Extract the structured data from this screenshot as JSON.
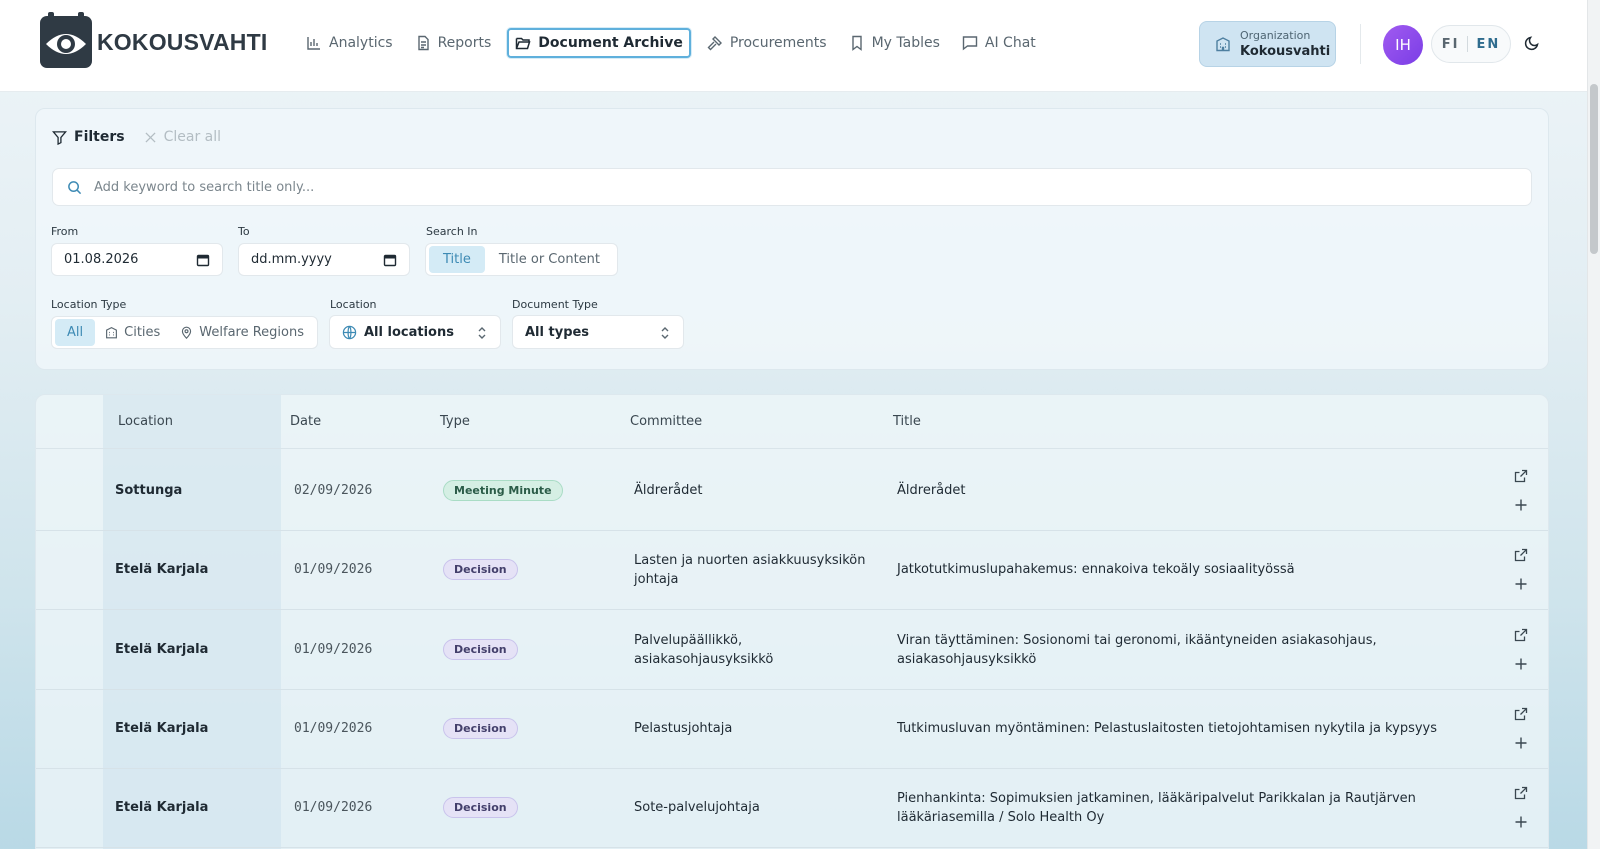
{
  "header": {
    "logo_text": "KOKOUSVAHTI",
    "nav": [
      {
        "label": "Analytics",
        "icon": "bar-chart-icon",
        "active": false
      },
      {
        "label": "Reports",
        "icon": "document-icon",
        "active": false
      },
      {
        "label": "Document Archive",
        "icon": "folder-open-icon",
        "active": true
      },
      {
        "label": "Procurements",
        "icon": "gavel-icon",
        "active": false
      },
      {
        "label": "My Tables",
        "icon": "bookmark-icon",
        "active": false
      },
      {
        "label": "AI Chat",
        "icon": "chat-icon",
        "active": false
      }
    ],
    "org_label": "Organization",
    "org_name": "Kokousvahti",
    "avatar_initials": "IH",
    "lang_fi": "FI",
    "lang_en": "EN"
  },
  "filters": {
    "title": "Filters",
    "clear_all": "Clear all",
    "search_placeholder": "Add keyword to search title only...",
    "from_label": "From",
    "from_value": "01.08.2026",
    "to_label": "To",
    "to_placeholder": "dd.mm.yyyy",
    "search_in_label": "Search In",
    "search_in_options": [
      "Title",
      "Title or Content"
    ],
    "location_type_label": "Location Type",
    "location_type_options": [
      "All",
      "Cities",
      "Welfare Regions"
    ],
    "location_label": "Location",
    "location_value": "All locations",
    "document_type_label": "Document Type",
    "document_type_value": "All types"
  },
  "table": {
    "columns": [
      "Location",
      "Date",
      "Type",
      "Committee",
      "Title"
    ],
    "rows": [
      {
        "location": "Sottunga",
        "date": "02/09/2026",
        "type": "Meeting Minute",
        "committee": [
          "Äldrerådet"
        ],
        "title": [
          "Äldrerådet"
        ]
      },
      {
        "location": "Etelä Karjala",
        "date": "01/09/2026",
        "type": "Decision",
        "committee": [
          "Lasten ja nuorten asiakkuusyksikön",
          "johtaja"
        ],
        "title": [
          "Jatkotutkimuslupahakemus: ennakoiva tekoäly sosiaalityössä"
        ]
      },
      {
        "location": "Etelä Karjala",
        "date": "01/09/2026",
        "type": "Decision",
        "committee": [
          "Palvelupäällikkö,",
          "asiakasohjausyksikkö"
        ],
        "title": [
          "Viran täyttäminen: Sosionomi tai geronomi, ikääntyneiden asiakasohjaus,",
          "asiakasohjausyksikkö"
        ]
      },
      {
        "location": "Etelä Karjala",
        "date": "01/09/2026",
        "type": "Decision",
        "committee": [
          "Pelastusjohtaja"
        ],
        "title": [
          "Tutkimusluvan myöntäminen: Pelastuslaitosten tietojohtamisen nykytila ja kypsyys"
        ]
      },
      {
        "location": "Etelä Karjala",
        "date": "01/09/2026",
        "type": "Decision",
        "committee": [
          "Sote-palvelujohtaja"
        ],
        "title": [
          "Pienhankinta: Sopimuksien jatkaminen, lääkäripalvelut Parikkalan ja Rautjärven",
          "lääkäriasemilla / Solo Health Oy"
        ]
      }
    ]
  },
  "colors": {
    "accent": "#5fb0dc",
    "avatar": "#8b4cec",
    "badge_meeting_minute": "#d5efe4",
    "badge_decision": "#e5e2f6"
  }
}
